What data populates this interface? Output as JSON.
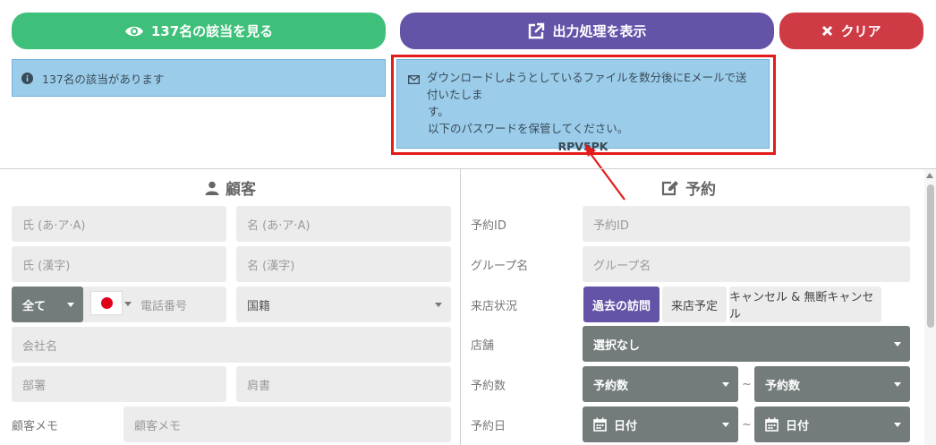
{
  "top_buttons": {
    "view_label": "137名の該当を見る",
    "export_label": "出力処理を表示",
    "clear_label": "クリア"
  },
  "alerts": {
    "count_text": "137名の該当があります",
    "download_line1": "ダウンロードしようとしているファイルを数分後にEメールで送付いたしま",
    "download_line2": "す。",
    "download_line3": "以下のパスワードを保管してください。",
    "password": "RPV5PK"
  },
  "customer": {
    "title": "顧客",
    "last_name_kana_placeholder": "氏 (あ·ア·A)",
    "first_name_kana_placeholder": "名 (あ·ア·A)",
    "last_name_kanji_placeholder": "氏 (漢字)",
    "first_name_kanji_placeholder": "名 (漢字)",
    "phone_scope": "全て",
    "phone_placeholder": "電話番号",
    "nationality_label": "国籍",
    "company_placeholder": "会社名",
    "department_placeholder": "部署",
    "position_placeholder": "肩書",
    "memo_label": "顧客メモ",
    "memo_placeholder": "顧客メモ"
  },
  "reservation": {
    "title": "予約",
    "id_label": "予約ID",
    "id_placeholder": "予約ID",
    "group_label": "グループ名",
    "group_placeholder": "グループ名",
    "visit_status_label": "来店状況",
    "visit_status_options": [
      "過去の訪問",
      "来店予定",
      "キャンセル & 無断キャンセル"
    ],
    "visit_status_selected": "過去の訪問",
    "store_label": "店舗",
    "store_value": "選択なし",
    "count_label": "予約数",
    "count_from": "予約数",
    "count_to": "予約数",
    "date_label": "予約日",
    "date_from": "日付",
    "date_to": "日付",
    "range_sep": "~"
  },
  "colors": {
    "green": "#3ec07a",
    "purple": "#6553a8",
    "red": "#cf3b45",
    "info_bg": "#9bcdeb",
    "highlight": "#e41b1b"
  }
}
